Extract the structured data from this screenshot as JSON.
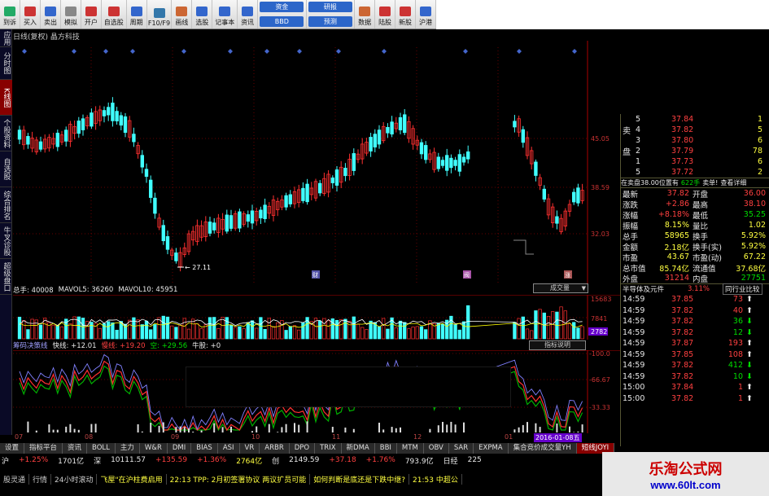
{
  "toolbar": {
    "buttons": [
      {
        "label": "到诉",
        "color": "#2a6"
      },
      {
        "label": "买入",
        "color": "#c33"
      },
      {
        "label": "卖出",
        "color": "#36c"
      },
      {
        "label": "模拟",
        "color": "#888"
      },
      {
        "label": "开户",
        "color": "#c33"
      },
      {
        "label": "自选股",
        "color": "#c33"
      },
      {
        "label": "周期",
        "color": "#36c"
      },
      {
        "label": "F10/F9",
        "color": "#37a"
      },
      {
        "label": "画线",
        "color": "#c63"
      },
      {
        "label": "选股",
        "color": "#36c"
      },
      {
        "label": "记事本",
        "color": "#36c"
      },
      {
        "label": "资讯",
        "color": "#36c"
      }
    ],
    "group1": [
      "资金",
      "BBD"
    ],
    "group2": [
      "研报",
      "预测"
    ],
    "buttons2": [
      {
        "label": "数据",
        "color": "#c63"
      },
      {
        "label": "陆股",
        "color": "#c33"
      },
      {
        "label": "新股",
        "color": "#c33"
      },
      {
        "label": "沪港",
        "color": "#36c"
      }
    ]
  },
  "sidebar": [
    "应用",
    "分时图",
    "K线图",
    "个股资料",
    "自选股",
    "综合排名",
    "牛叉诊股",
    "超级盘口"
  ],
  "title": "日线(复权)  晶方科技",
  "price_axis": [
    "45.05",
    "38.59",
    "32.03"
  ],
  "low_label": "27.11",
  "event_markers": [
    "财",
    "阀",
    "涨"
  ],
  "volume_header": {
    "label": "总手: 40008",
    "ma5": "MAVOL5: 36260",
    "ma10": "MAVOL10: 45951"
  },
  "volume_axis": [
    "15683",
    "7841",
    "2782"
  ],
  "dropdown": "成交量",
  "indicator_header": {
    "name": "筹码决策线",
    "fast": "快线: +12.01",
    "slow": "慢线: +19.20",
    "kong": "空: +29.56",
    "niu": "牛股: +0"
  },
  "indicator_button": "指标说明",
  "indicator_axis": [
    "100.0",
    "66.67",
    "33.33"
  ],
  "x_axis": [
    "07",
    "08",
    "09",
    "10",
    "11",
    "12",
    "01"
  ],
  "date_badge": "2016-01-08五",
  "tabs": [
    "设置",
    "指标平台",
    "资讯",
    "BOLL",
    "主力",
    "W&R",
    "DMI",
    "BIAS",
    "ASI",
    "VR",
    "ARBR",
    "DPO",
    "TRIX",
    "新DMA",
    "BBI",
    "MTM",
    "OBV",
    "SAR",
    "EXPMA",
    "集合竞价成交量YH",
    "短线JOYI"
  ],
  "bottom1": [
    "沪",
    "+1.25%",
    "1701亿",
    "深",
    "10111.57",
    "+135.59",
    "+1.36%",
    "2764亿",
    "创",
    "2149.59",
    "+37.18",
    "+1.76%",
    "793.9亿",
    "日经",
    "225"
  ],
  "bottom2": [
    "股灵通",
    "行情",
    "24小时滚动",
    "飞屋\"在沪柱费启用",
    "22:13 TPP: 2月初签署协议 两议扩员可能",
    "如何判断是底还是下跌中继?",
    "21:53 中超公"
  ],
  "right_panel": {
    "sell": [
      {
        "n": "5",
        "p": "37.84",
        "v": "1"
      },
      {
        "n": "4",
        "p": "37.82",
        "v": "5"
      },
      {
        "n": "3",
        "p": "37.80",
        "v": "6"
      },
      {
        "n": "2",
        "p": "37.79",
        "v": "78"
      },
      {
        "n": "1",
        "p": "37.73",
        "v": "6"
      }
    ],
    "sell_label": "卖盘",
    "buy": [
      {
        "n": "5",
        "p": "37.72",
        "v": "2"
      }
    ],
    "info_line": {
      "a": "在卖盘38.00位置有",
      "b": "622手",
      "c": "卖单!",
      "d": "查看详细"
    },
    "stats": [
      {
        "k": "最新",
        "v": "37.82",
        "k2": "开盘",
        "v2": "36.00"
      },
      {
        "k": "涨跌",
        "v": "+2.86",
        "k2": "最高",
        "v2": "38.10"
      },
      {
        "k": "涨幅",
        "v": "+8.18%",
        "k2": "最低",
        "v2": "35.25"
      },
      {
        "k": "振幅",
        "v": "8.15%",
        "k2": "量比",
        "v2": "1.02"
      },
      {
        "k": "总手",
        "v": "58965",
        "k2": "换手",
        "v2": "5.92%"
      },
      {
        "k": "金额",
        "v": "2.18亿",
        "k2": "换手(实)",
        "v2": "5.92%"
      },
      {
        "k": "市盈",
        "v": "43.67",
        "k2": "市盈(动)",
        "v2": "67.22"
      },
      {
        "k": "总市值",
        "v": "85.74亿",
        "k2": "流通值",
        "v2": "37.68亿"
      },
      {
        "k": "外盘",
        "v": "31214",
        "k2": "内盘",
        "v2": "27751"
      }
    ],
    "industry": {
      "name": "半导体及元件",
      "pct": "3.11%",
      "btn": "同行业比较"
    },
    "ticks": [
      {
        "t": "14:59",
        "p": "37.85",
        "v": "73",
        "d": "up"
      },
      {
        "t": "14:59",
        "p": "37.82",
        "v": "40",
        "d": "up"
      },
      {
        "t": "14:59",
        "p": "37.82",
        "v": "36",
        "d": "dn"
      },
      {
        "t": "14:59",
        "p": "37.82",
        "v": "12",
        "d": "dn"
      },
      {
        "t": "14:59",
        "p": "37.87",
        "v": "193",
        "d": "up"
      },
      {
        "t": "14:59",
        "p": "37.85",
        "v": "108",
        "d": "up"
      },
      {
        "t": "14:59",
        "p": "37.82",
        "v": "412",
        "d": "dn"
      },
      {
        "t": "14:59",
        "p": "37.82",
        "v": "10",
        "d": "dn"
      },
      {
        "t": "15:00",
        "p": "37.84",
        "v": "1",
        "d": "up"
      },
      {
        "t": "15:00",
        "p": "37.82",
        "v": "1",
        "d": "up"
      }
    ]
  },
  "watermark": {
    "line1": "乐淘公式网",
    "line2": "www.60lt.com"
  }
}
